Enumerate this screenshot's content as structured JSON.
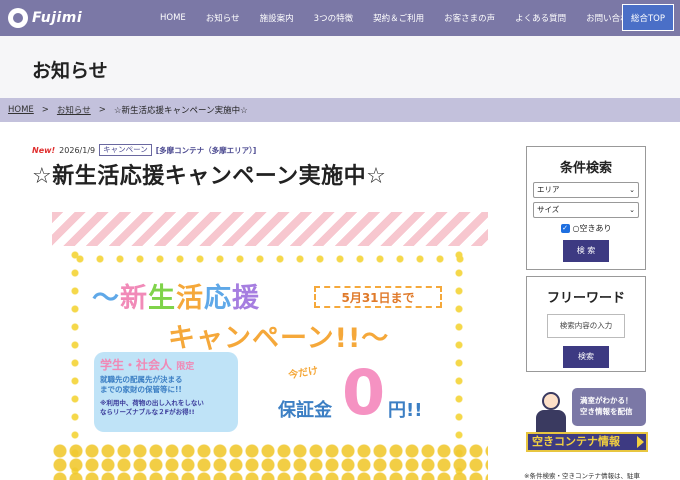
{
  "header": {
    "logo_text": "Fujimi",
    "nav": [
      "HOME",
      "お知らせ",
      "施設案内",
      "3つの特徴",
      "契約＆ご利用",
      "お客さまの声",
      "よくある質問",
      "お問い合わせ"
    ],
    "top_button": "総合TOP"
  },
  "page_title": "お知らせ",
  "breadcrumb": {
    "home": "HOME",
    "sep": ">",
    "news": "お知らせ",
    "current": "☆新生活応援キャンペーン実施中☆"
  },
  "post": {
    "new_badge": "New!",
    "date": "2026/1/9",
    "category": "キャンペーン",
    "area": "[多摩コンテナ（多摩エリア）]",
    "title": "☆新生活応援キャンペーン実施中☆"
  },
  "banner": {
    "line1_a": "～",
    "line1_b": "新",
    "line1_c": "生",
    "line1_d": "活",
    "line1_e": "応",
    "line1_f": "援",
    "deadline": "5月31日まで",
    "line2": "キャンペーン!!～",
    "student_head": "学生・社会人",
    "student_limited": "限定",
    "student_p1": "就職先の配属先が決まる",
    "student_p2": "までの家財の保管等に!!",
    "student_p3": "※利用中、荷物の出し入れをしない",
    "student_p4": "ならリーズナブルな２Fがお得!!",
    "only_now": "今だけ",
    "deposit": "保証金",
    "zero": "0",
    "yen": "円!!"
  },
  "sidebar": {
    "search_head": "条件検索",
    "area_select": "エリア",
    "size_select": "サイズ",
    "vacancy_check": "○空きあり",
    "search_btn": "検 索",
    "free_head": "フリーワード",
    "free_placeholder": "検索内容の入力",
    "free_btn": "検索",
    "vac_msg1": "満室がわかる！",
    "vac_msg2": "空き情報を配信",
    "vac_bar": "空きコンテナ情報",
    "note": "※条件検索・空きコンテナ情報は、駐車"
  },
  "colors": {
    "header_bg": "#7b78a6",
    "crumb_bg": "#c3c1dc",
    "button_bg": "#3d3a82",
    "top_button_bg": "#4a6fc7"
  }
}
